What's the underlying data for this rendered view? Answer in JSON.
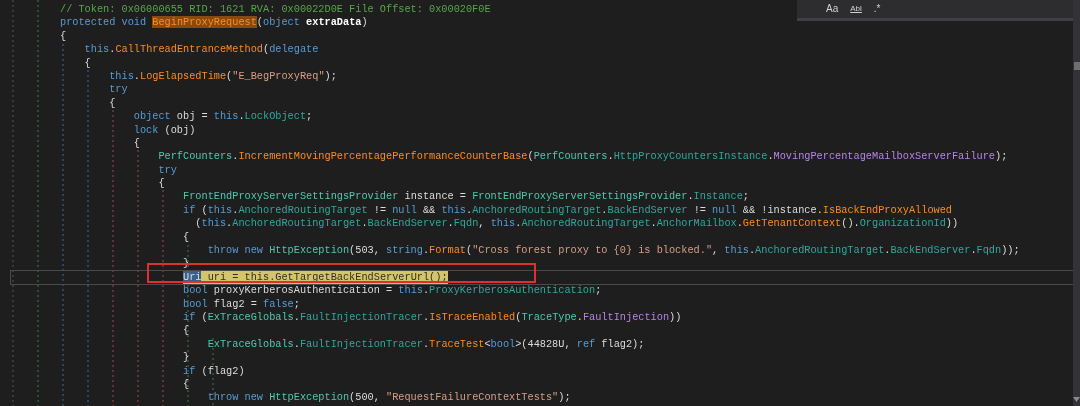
{
  "find_panel": {
    "options": [
      {
        "label": "Aa",
        "kind": "case",
        "selected": false
      },
      {
        "label": "Abl",
        "kind": "word",
        "selected": false
      },
      {
        "label": ".*",
        "kind": "regex",
        "selected": false
      }
    ]
  },
  "code": {
    "lines": [
      {
        "current": false,
        "boxed": false,
        "tokens": [
          {
            "text": "// Token: 0x06000655 RID: 1621 RVA: 0x00022D0E File Offset: 0x00020F0E",
            "kind": "comment"
          }
        ]
      },
      {
        "current": false,
        "boxed": false,
        "tokens": [
          {
            "text": "protected ",
            "kind": "keyword"
          },
          {
            "text": "void ",
            "kind": "keyword"
          },
          {
            "text": "BeginProxyRequest",
            "kind": "method",
            "highlighted": true
          },
          {
            "text": "(",
            "kind": "plain"
          },
          {
            "text": "object ",
            "kind": "keyword"
          },
          {
            "text": "extraData",
            "kind": "param"
          },
          {
            "text": ")",
            "kind": "plain"
          }
        ]
      },
      {
        "current": false,
        "boxed": false,
        "tokens": [
          {
            "text": "{",
            "kind": "plain"
          }
        ]
      },
      {
        "current": false,
        "boxed": false,
        "tokens": [
          {
            "text": "    this",
            "kind": "keyword"
          },
          {
            "text": ".",
            "kind": "plain"
          },
          {
            "text": "CallThreadEntranceMethod",
            "kind": "method"
          },
          {
            "text": "(",
            "kind": "plain"
          },
          {
            "text": "delegate",
            "kind": "keyword"
          }
        ]
      },
      {
        "current": false,
        "boxed": false,
        "tokens": [
          {
            "text": "    {",
            "kind": "plain"
          }
        ]
      },
      {
        "current": false,
        "boxed": false,
        "tokens": [
          {
            "text": "        this",
            "kind": "keyword"
          },
          {
            "text": ".",
            "kind": "plain"
          },
          {
            "text": "LogElapsedTime",
            "kind": "method"
          },
          {
            "text": "(",
            "kind": "plain"
          },
          {
            "text": "\"E_BegProxyReq\"",
            "kind": "string"
          },
          {
            "text": ");",
            "kind": "plain"
          }
        ]
      },
      {
        "current": false,
        "boxed": false,
        "tokens": [
          {
            "text": "        try",
            "kind": "keyword"
          }
        ]
      },
      {
        "current": false,
        "boxed": false,
        "tokens": [
          {
            "text": "        {",
            "kind": "plain"
          }
        ]
      },
      {
        "current": false,
        "boxed": false,
        "tokens": [
          {
            "text": "            object",
            "kind": "keyword"
          },
          {
            "text": " obj = ",
            "kind": "plain"
          },
          {
            "text": "this",
            "kind": "keyword"
          },
          {
            "text": ".",
            "kind": "plain"
          },
          {
            "text": "LockObject",
            "kind": "property"
          },
          {
            "text": ";",
            "kind": "plain"
          }
        ]
      },
      {
        "current": false,
        "boxed": false,
        "tokens": [
          {
            "text": "            lock",
            "kind": "keyword"
          },
          {
            "text": " (obj)",
            "kind": "plain"
          }
        ]
      },
      {
        "current": false,
        "boxed": false,
        "tokens": [
          {
            "text": "            {",
            "kind": "plain"
          }
        ]
      },
      {
        "current": false,
        "boxed": false,
        "tokens": [
          {
            "text": "                PerfCounters",
            "kind": "type"
          },
          {
            "text": ".",
            "kind": "plain"
          },
          {
            "text": "IncrementMovingPercentagePerformanceCounterBase",
            "kind": "method"
          },
          {
            "text": "(",
            "kind": "plain"
          },
          {
            "text": "PerfCounters",
            "kind": "type"
          },
          {
            "text": ".",
            "kind": "plain"
          },
          {
            "text": "HttpProxyCountersInstance",
            "kind": "property"
          },
          {
            "text": ".",
            "kind": "plain"
          },
          {
            "text": "MovingPercentageMailboxServerFailure",
            "kind": "enum"
          },
          {
            "text": ");",
            "kind": "plain"
          }
        ]
      },
      {
        "current": false,
        "boxed": false,
        "tokens": [
          {
            "text": "                try",
            "kind": "keyword"
          }
        ]
      },
      {
        "current": false,
        "boxed": false,
        "tokens": [
          {
            "text": "                {",
            "kind": "plain"
          }
        ]
      },
      {
        "current": false,
        "boxed": false,
        "tokens": [
          {
            "text": "                    FrontEndProxyServerSettingsProvider",
            "kind": "type"
          },
          {
            "text": " instance = ",
            "kind": "plain"
          },
          {
            "text": "FrontEndProxyServerSettingsProvider",
            "kind": "type"
          },
          {
            "text": ".",
            "kind": "plain"
          },
          {
            "text": "Instance",
            "kind": "property"
          },
          {
            "text": ";",
            "kind": "plain"
          }
        ]
      },
      {
        "current": false,
        "boxed": false,
        "tokens": [
          {
            "text": "                    if",
            "kind": "keyword"
          },
          {
            "text": " (",
            "kind": "plain"
          },
          {
            "text": "this",
            "kind": "keyword"
          },
          {
            "text": ".",
            "kind": "plain"
          },
          {
            "text": "AnchoredRoutingTarget",
            "kind": "property"
          },
          {
            "text": " != ",
            "kind": "plain"
          },
          {
            "text": "null",
            "kind": "keyword"
          },
          {
            "text": " && ",
            "kind": "plain"
          },
          {
            "text": "this",
            "kind": "keyword"
          },
          {
            "text": ".",
            "kind": "plain"
          },
          {
            "text": "AnchoredRoutingTarget",
            "kind": "property"
          },
          {
            "text": ".",
            "kind": "plain"
          },
          {
            "text": "BackEndServer",
            "kind": "property"
          },
          {
            "text": " != ",
            "kind": "plain"
          },
          {
            "text": "null",
            "kind": "keyword"
          },
          {
            "text": " && !instance.",
            "kind": "plain"
          },
          {
            "text": "IsBackEndProxyAllowed",
            "kind": "method"
          }
        ]
      },
      {
        "current": false,
        "boxed": false,
        "tokens": [
          {
            "text": "                      (",
            "kind": "plain"
          },
          {
            "text": "this",
            "kind": "keyword"
          },
          {
            "text": ".",
            "kind": "plain"
          },
          {
            "text": "AnchoredRoutingTarget",
            "kind": "property"
          },
          {
            "text": ".",
            "kind": "plain"
          },
          {
            "text": "BackEndServer",
            "kind": "property"
          },
          {
            "text": ".",
            "kind": "plain"
          },
          {
            "text": "Fqdn",
            "kind": "property"
          },
          {
            "text": ", ",
            "kind": "plain"
          },
          {
            "text": "this",
            "kind": "keyword"
          },
          {
            "text": ".",
            "kind": "plain"
          },
          {
            "text": "AnchoredRoutingTarget",
            "kind": "property"
          },
          {
            "text": ".",
            "kind": "plain"
          },
          {
            "text": "AnchorMailbox",
            "kind": "property"
          },
          {
            "text": ".",
            "kind": "plain"
          },
          {
            "text": "GetTenantContext",
            "kind": "method"
          },
          {
            "text": "().",
            "kind": "plain"
          },
          {
            "text": "OrganizationId",
            "kind": "property"
          },
          {
            "text": "))",
            "kind": "plain"
          }
        ]
      },
      {
        "current": false,
        "boxed": false,
        "tokens": [
          {
            "text": "                    {",
            "kind": "plain"
          }
        ]
      },
      {
        "current": false,
        "boxed": false,
        "tokens": [
          {
            "text": "                        throw ",
            "kind": "keyword"
          },
          {
            "text": "new ",
            "kind": "keyword"
          },
          {
            "text": "HttpException",
            "kind": "type"
          },
          {
            "text": "(503, ",
            "kind": "plain"
          },
          {
            "text": "string",
            "kind": "keyword"
          },
          {
            "text": ".",
            "kind": "plain"
          },
          {
            "text": "Format",
            "kind": "method"
          },
          {
            "text": "(",
            "kind": "plain"
          },
          {
            "text": "\"Cross forest proxy to {0} is blocked.\"",
            "kind": "string"
          },
          {
            "text": ", ",
            "kind": "plain"
          },
          {
            "text": "this",
            "kind": "keyword"
          },
          {
            "text": ".",
            "kind": "plain"
          },
          {
            "text": "AnchoredRoutingTarget",
            "kind": "property"
          },
          {
            "text": ".",
            "kind": "plain"
          },
          {
            "text": "BackEndServer",
            "kind": "property"
          },
          {
            "text": ".",
            "kind": "plain"
          },
          {
            "text": "Fqdn",
            "kind": "property"
          },
          {
            "text": "));",
            "kind": "plain"
          }
        ]
      },
      {
        "current": false,
        "boxed": false,
        "tokens": [
          {
            "text": "                    }",
            "kind": "plain"
          }
        ]
      },
      {
        "current": true,
        "boxed": true,
        "tokens": [
          {
            "text": "                    Uri",
            "kind": "type",
            "selected": true
          },
          {
            "text": " uri = ",
            "kind": "plain"
          },
          {
            "text": "this",
            "kind": "keyword"
          },
          {
            "text": ".",
            "kind": "plain"
          },
          {
            "text": "GetTargetBackEndServerUrl",
            "kind": "method"
          },
          {
            "text": "();",
            "kind": "plain"
          }
        ]
      },
      {
        "current": false,
        "boxed": false,
        "tokens": [
          {
            "text": "                    bool",
            "kind": "keyword"
          },
          {
            "text": " proxyKerberosAuthentication = ",
            "kind": "plain"
          },
          {
            "text": "this",
            "kind": "keyword"
          },
          {
            "text": ".",
            "kind": "plain"
          },
          {
            "text": "ProxyKerberosAuthentication",
            "kind": "property"
          },
          {
            "text": ";",
            "kind": "plain"
          }
        ]
      },
      {
        "current": false,
        "boxed": false,
        "tokens": [
          {
            "text": "                    bool",
            "kind": "keyword"
          },
          {
            "text": " flag2 = ",
            "kind": "plain"
          },
          {
            "text": "false",
            "kind": "keyword"
          },
          {
            "text": ";",
            "kind": "plain"
          }
        ]
      },
      {
        "current": false,
        "boxed": false,
        "tokens": [
          {
            "text": "                    if",
            "kind": "keyword"
          },
          {
            "text": " (",
            "kind": "plain"
          },
          {
            "text": "ExTraceGlobals",
            "kind": "type"
          },
          {
            "text": ".",
            "kind": "plain"
          },
          {
            "text": "FaultInjectionTracer",
            "kind": "property"
          },
          {
            "text": ".",
            "kind": "plain"
          },
          {
            "text": "IsTraceEnabled",
            "kind": "method"
          },
          {
            "text": "(",
            "kind": "plain"
          },
          {
            "text": "TraceType",
            "kind": "type"
          },
          {
            "text": ".",
            "kind": "plain"
          },
          {
            "text": "FaultInjection",
            "kind": "enum"
          },
          {
            "text": "))",
            "kind": "plain"
          }
        ]
      },
      {
        "current": false,
        "boxed": false,
        "tokens": [
          {
            "text": "                    {",
            "kind": "plain"
          }
        ]
      },
      {
        "current": false,
        "boxed": false,
        "tokens": [
          {
            "text": "                        ExTraceGlobals",
            "kind": "type"
          },
          {
            "text": ".",
            "kind": "plain"
          },
          {
            "text": "FaultInjectionTracer",
            "kind": "property"
          },
          {
            "text": ".",
            "kind": "plain"
          },
          {
            "text": "TraceTest",
            "kind": "method"
          },
          {
            "text": "<",
            "kind": "plain"
          },
          {
            "text": "bool",
            "kind": "keyword"
          },
          {
            "text": ">(44828U, ",
            "kind": "plain"
          },
          {
            "text": "ref",
            "kind": "keyword"
          },
          {
            "text": " flag2);",
            "kind": "plain"
          }
        ]
      },
      {
        "current": false,
        "boxed": false,
        "tokens": [
          {
            "text": "                    }",
            "kind": "plain"
          }
        ]
      },
      {
        "current": false,
        "boxed": false,
        "tokens": [
          {
            "text": "                    if",
            "kind": "keyword"
          },
          {
            "text": " (flag2)",
            "kind": "plain"
          }
        ]
      },
      {
        "current": false,
        "boxed": false,
        "tokens": [
          {
            "text": "                    {",
            "kind": "plain"
          }
        ]
      },
      {
        "current": false,
        "boxed": false,
        "tokens": [
          {
            "text": "                        throw ",
            "kind": "keyword"
          },
          {
            "text": "new ",
            "kind": "keyword"
          },
          {
            "text": "HttpException",
            "kind": "type"
          },
          {
            "text": "(500, ",
            "kind": "plain"
          },
          {
            "text": "\"RequestFailureContextTests\"",
            "kind": "string"
          },
          {
            "text": ");",
            "kind": "plain"
          }
        ]
      }
    ]
  }
}
